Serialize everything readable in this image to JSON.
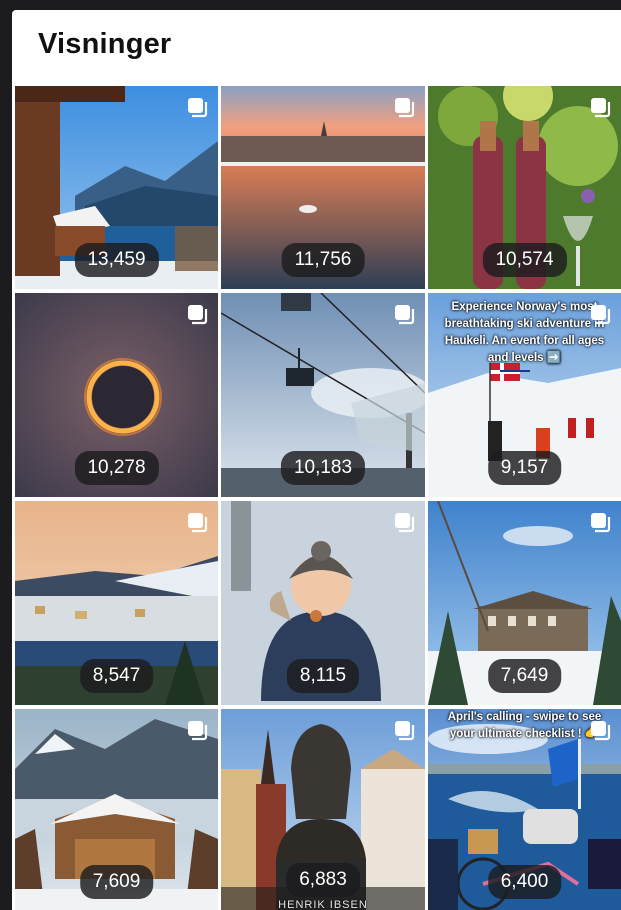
{
  "page": {
    "title": "Visninger"
  },
  "tiles": [
    {
      "views": "13,459"
    },
    {
      "views": "11,756"
    },
    {
      "views": "10,574"
    },
    {
      "views": "10,278"
    },
    {
      "views": "10,183"
    },
    {
      "views": "9,157",
      "caption": "Experience Norway's most breathtaking ski adventure in Haukeli. An event for all ages and levels ➡️"
    },
    {
      "views": "8,547"
    },
    {
      "views": "8,115"
    },
    {
      "views": "7,649"
    },
    {
      "views": "7,609"
    },
    {
      "views": "6,883",
      "caption": "HENRIK IBSEN"
    },
    {
      "views": "6,400",
      "caption": "April's calling - swipe to see your ultimate checklist ! 👉"
    }
  ],
  "icons": {
    "carousel": "carousel-icon"
  }
}
